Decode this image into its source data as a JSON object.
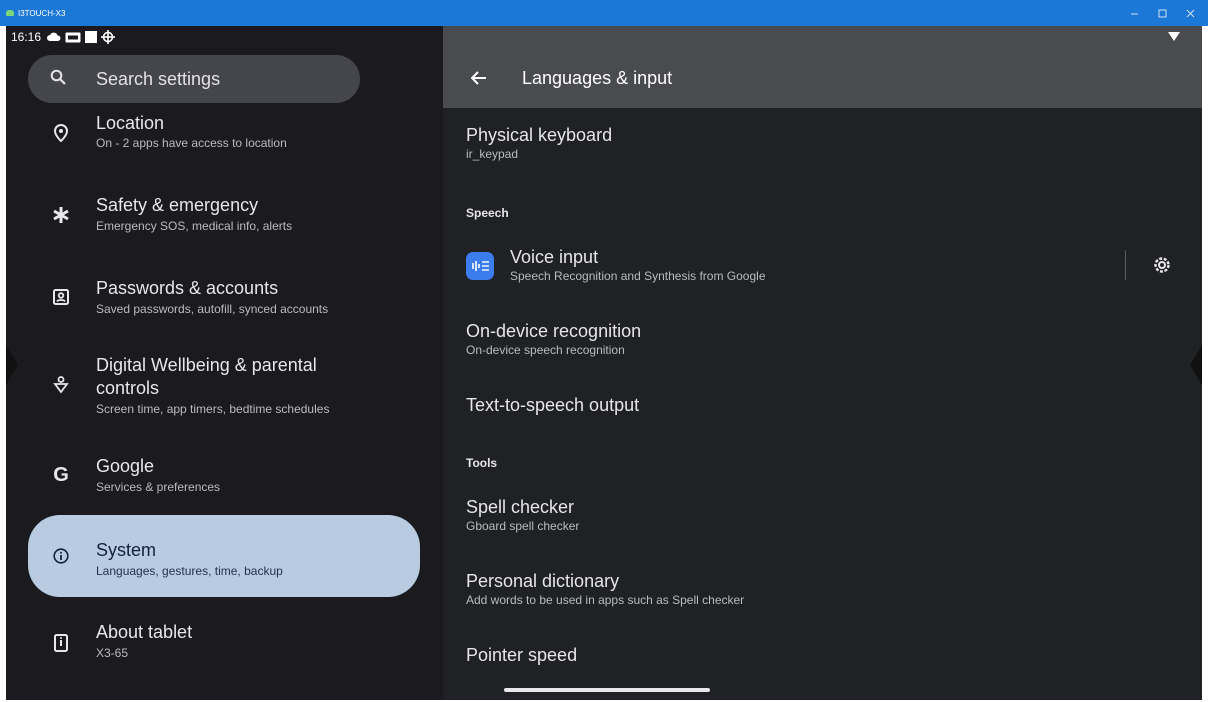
{
  "window": {
    "title": "I3TOUCH-X3"
  },
  "status_bar": {
    "time": "16:16"
  },
  "left": {
    "search": {
      "placeholder": "Search settings"
    },
    "items": [
      {
        "title": "Location",
        "subtitle": "On - 2 apps have access to location",
        "icon": "location-pin-icon"
      },
      {
        "title": "Safety & emergency",
        "subtitle": "Emergency SOS, medical info, alerts",
        "icon": "asterisk-icon"
      },
      {
        "title": "Passwords & accounts",
        "subtitle": "Saved passwords, autofill, synced accounts",
        "icon": "account-box-icon"
      },
      {
        "title_line1": "Digital Wellbeing & parental",
        "title_line2": "controls",
        "subtitle": "Screen time, app timers, bedtime schedules",
        "icon": "wellbeing-icon"
      },
      {
        "title": "Google",
        "subtitle": "Services & preferences",
        "icon": "google-g-icon"
      },
      {
        "title": "System",
        "subtitle": "Languages, gestures, time, backup",
        "icon": "info-icon",
        "selected": true
      },
      {
        "title": "About tablet",
        "subtitle": "X3-65",
        "icon": "tablet-icon"
      }
    ]
  },
  "right": {
    "title": "Languages & input",
    "physical_keyboard": {
      "title": "Physical keyboard",
      "subtitle": "ir_keypad"
    },
    "speech_header": "Speech",
    "voice_input": {
      "title": "Voice input",
      "subtitle": "Speech Recognition and Synthesis from Google"
    },
    "on_device": {
      "title": "On-device recognition",
      "subtitle": "On-device speech recognition"
    },
    "tts": {
      "title": "Text-to-speech output"
    },
    "tools_header": "Tools",
    "spell_checker": {
      "title": "Spell checker",
      "subtitle": "Gboard spell checker"
    },
    "personal_dictionary": {
      "title": "Personal dictionary",
      "subtitle": "Add words to be used in apps such as Spell checker"
    },
    "pointer_speed": {
      "title": "Pointer speed"
    }
  },
  "colors": {
    "title_bar": "#1b78d6",
    "selected_item": "#b8cbe0",
    "right_header": "#4a4b4e",
    "voice_icon": "#3b7ded"
  }
}
